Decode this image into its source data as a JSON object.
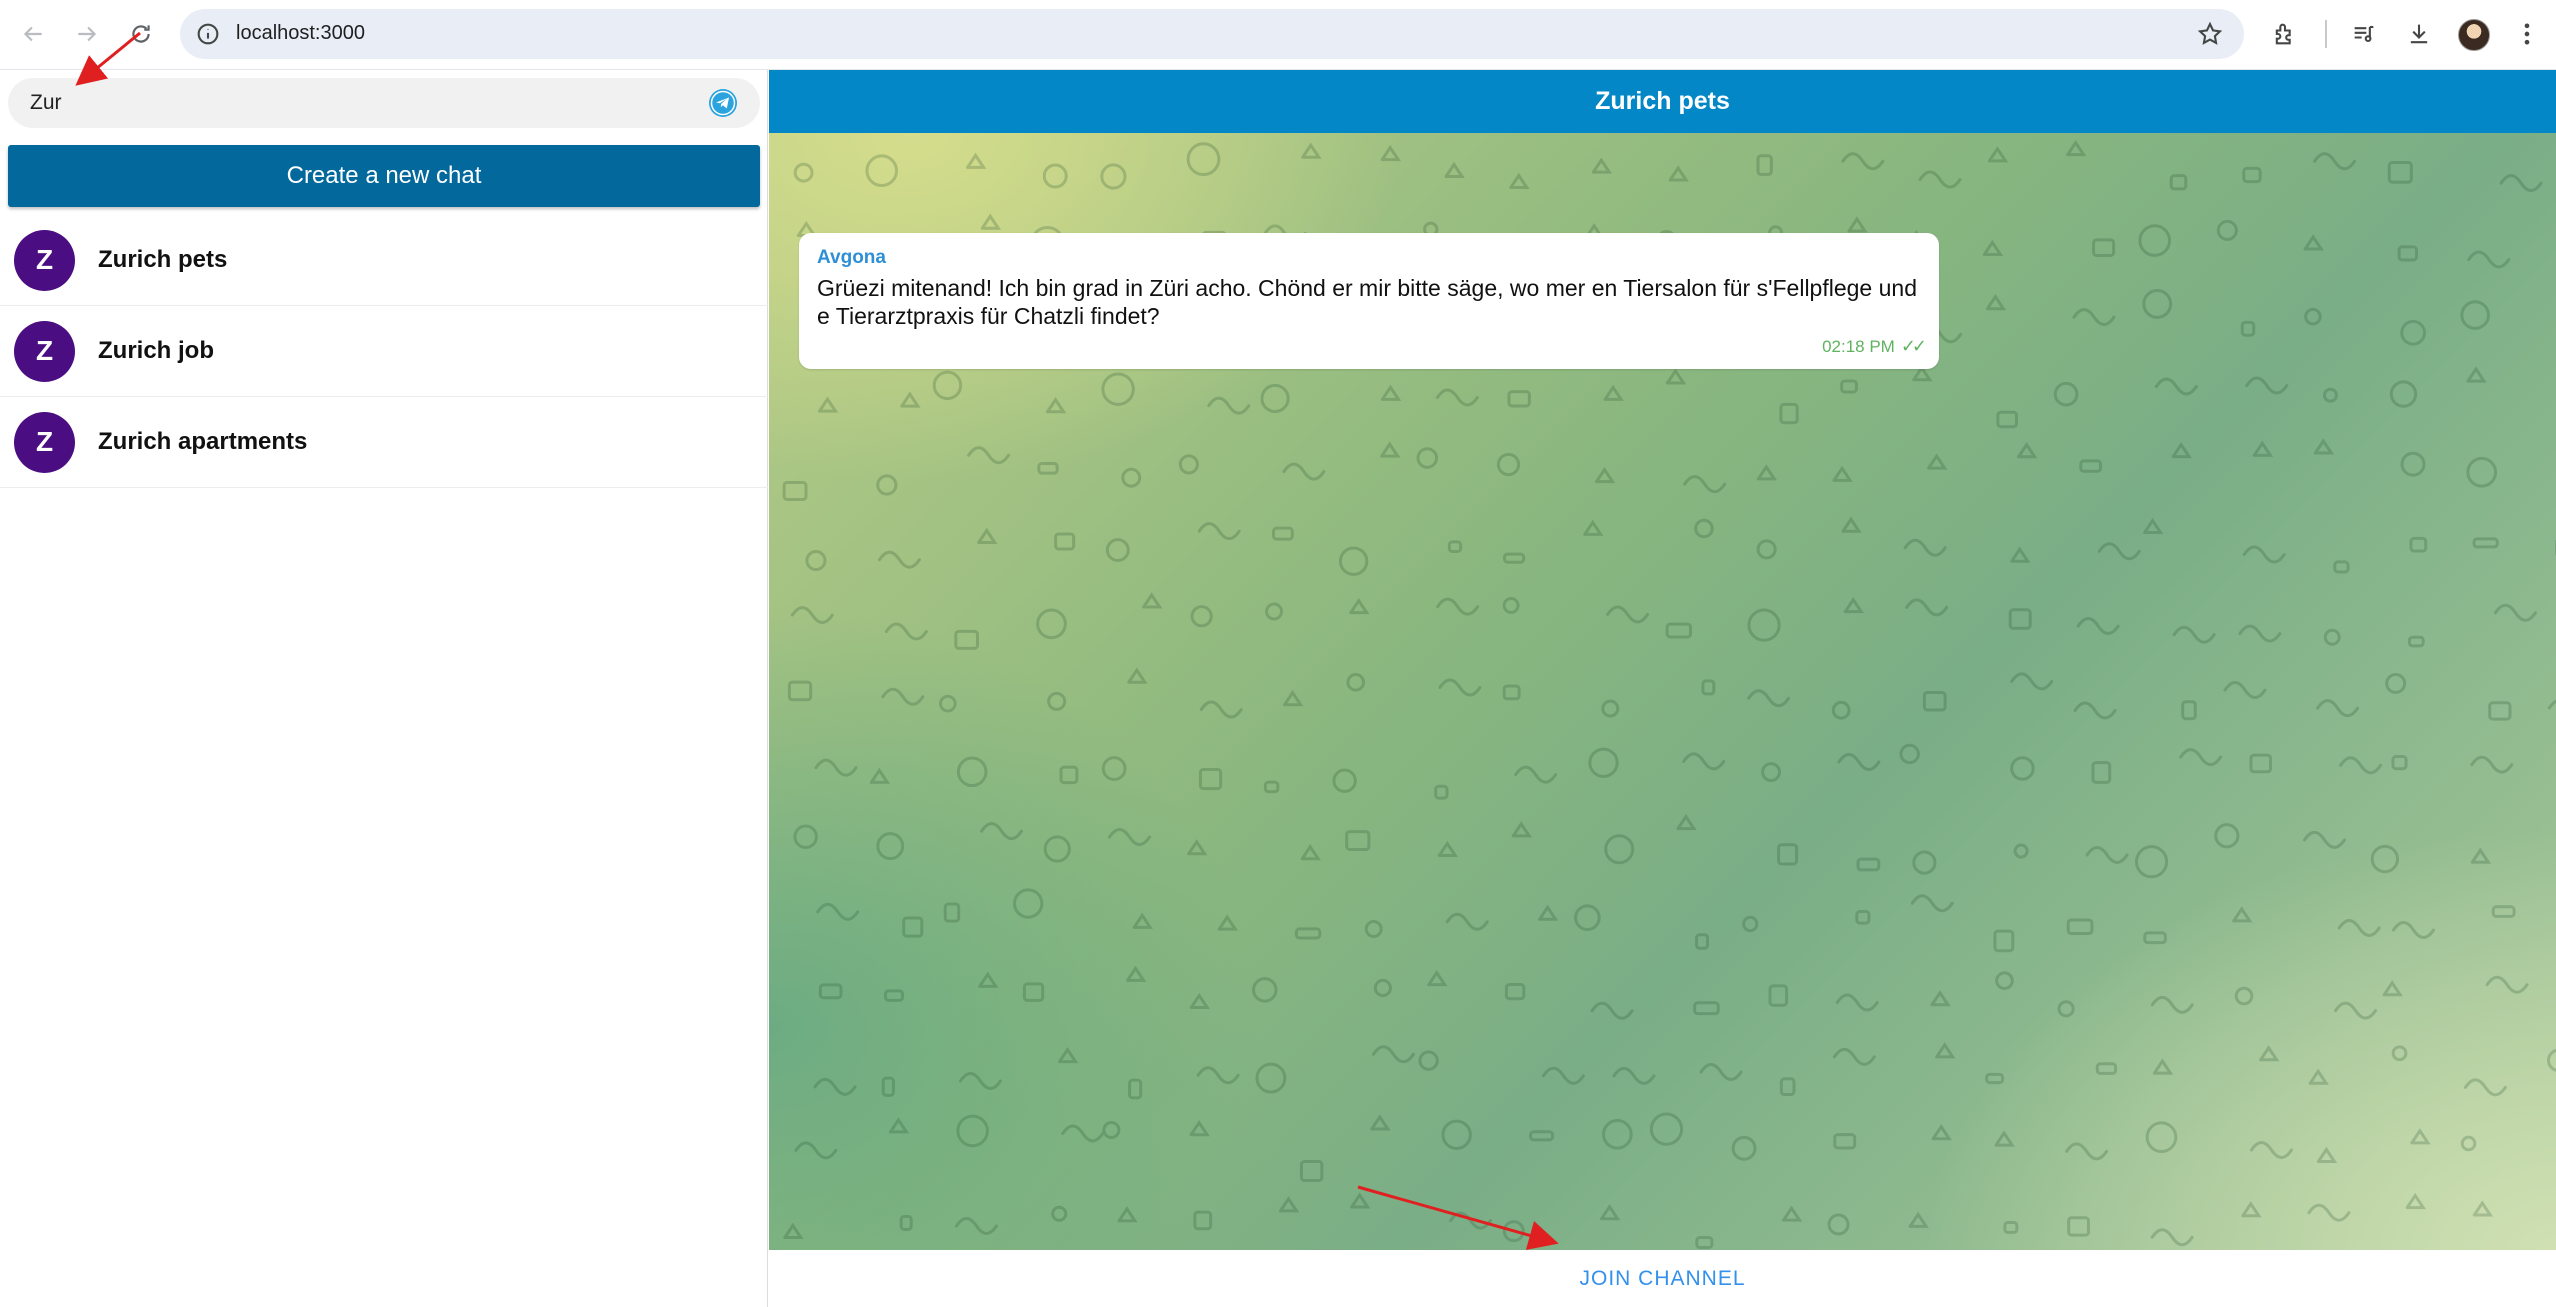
{
  "browser": {
    "url": "localhost:3000",
    "icons": [
      "back-icon",
      "forward-icon",
      "reload-icon",
      "site-info-icon",
      "bookmark-star-icon",
      "extensions-icon",
      "media-control-icon",
      "download-icon",
      "profile-avatar",
      "more-menu-icon"
    ]
  },
  "sidebar": {
    "search": {
      "value": "Zur",
      "placeholder": ""
    },
    "create_chat_label": "Create a new chat",
    "chats": [
      {
        "initial": "Z",
        "name": "Zurich pets"
      },
      {
        "initial": "Z",
        "name": "Zurich job"
      },
      {
        "initial": "Z",
        "name": "Zurich apartments"
      }
    ]
  },
  "chat": {
    "title": "Zurich pets",
    "messages": [
      {
        "sender": "Avgona",
        "text": "Grüezi mitenand! Ich bin grad in Züri acho. Chönd er mir bitte säge, wo mer en Tiersalon für s'Fellpflege und e Tierarztpraxis für Chatzli findet?",
        "time": "02:18 PM",
        "status": "✓✓"
      }
    ],
    "join_label": "JOIN CHANNEL"
  },
  "colors": {
    "header_blue": "#0387c7",
    "create_button": "#03689c",
    "avatar_purple": "#4a0d82",
    "sender_blue": "#2e8fd6",
    "join_blue": "#3390ec",
    "annotation_red": "#e02020"
  }
}
